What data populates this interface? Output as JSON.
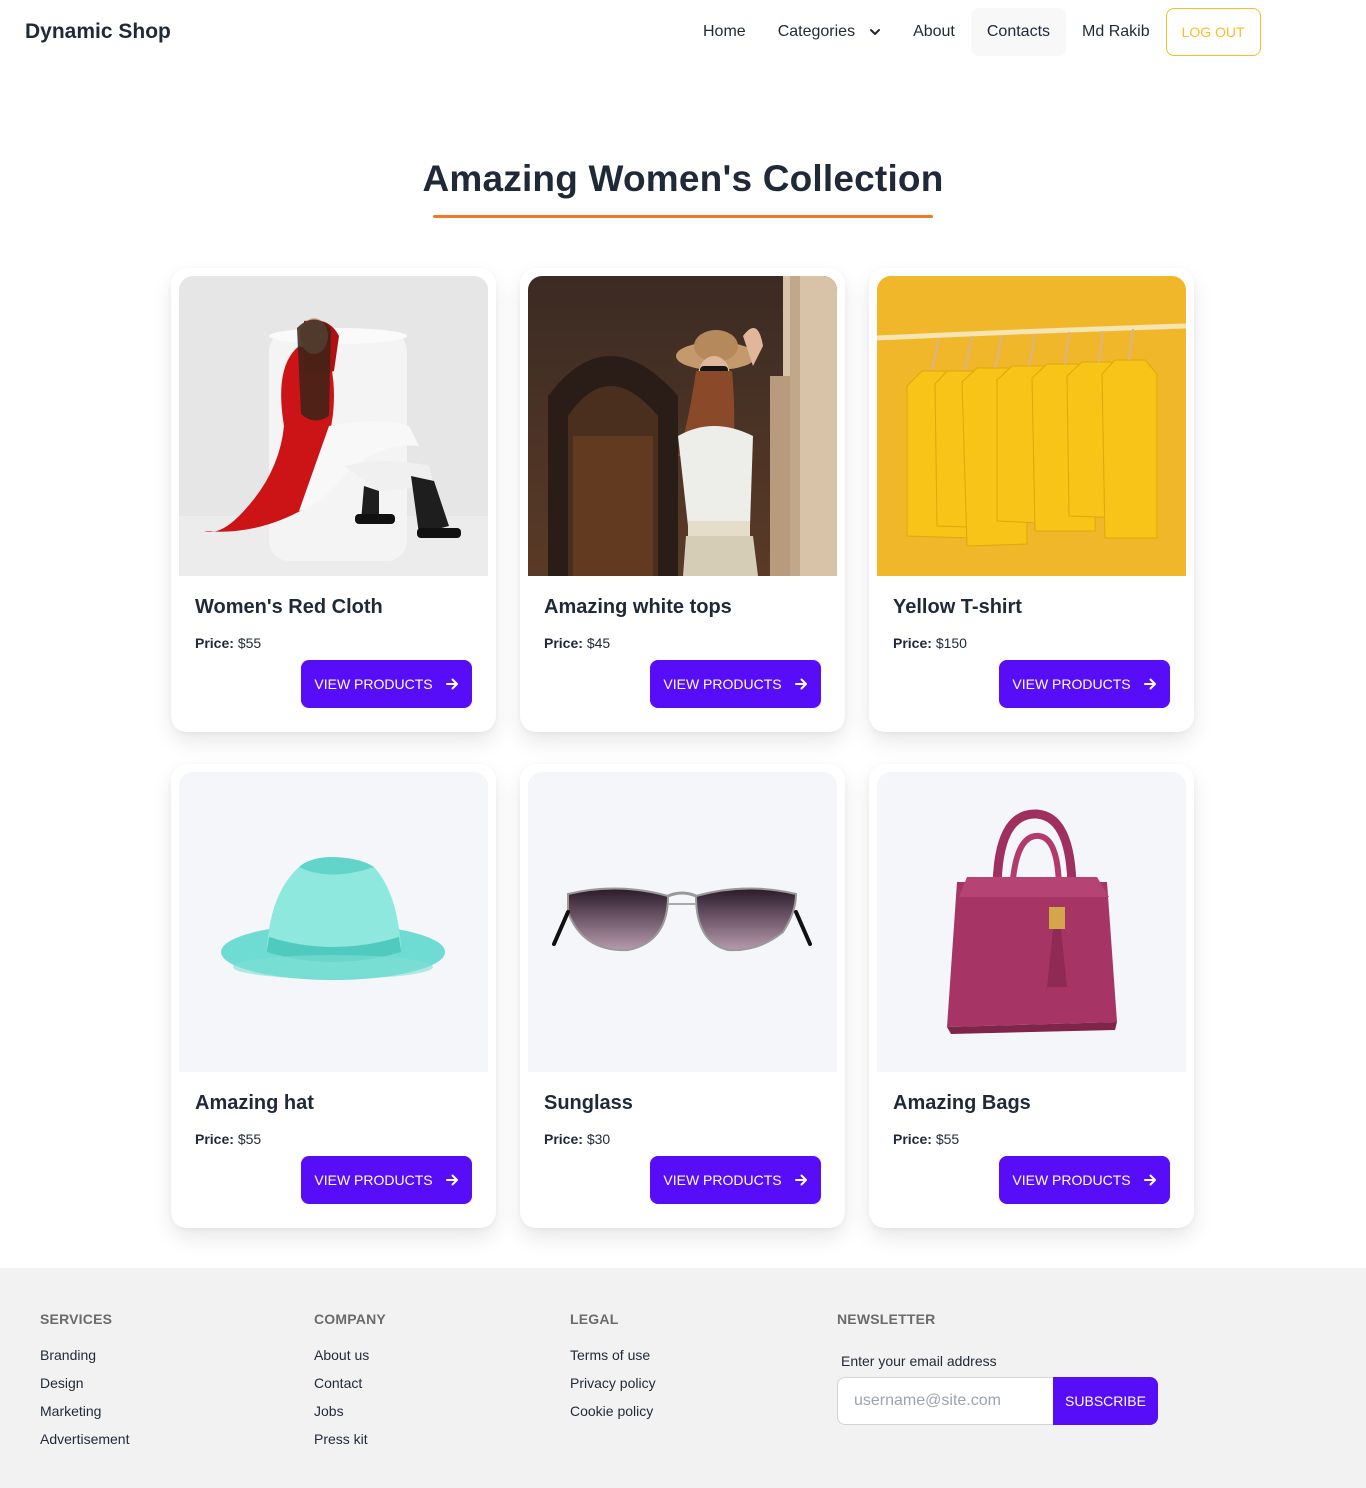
{
  "nav": {
    "brand": "Dynamic Shop",
    "links": [
      "Home",
      "Categories",
      "About",
      "Contacts",
      "Md Rakib"
    ],
    "logout": "LOG OUT"
  },
  "hero": {
    "title": "Amazing Women's Collection"
  },
  "products": [
    {
      "name": "Women's Red Cloth",
      "price_label": "Price:",
      "price": "$55",
      "button": "VIEW PRODUCTS"
    },
    {
      "name": "Amazing white tops",
      "price_label": "Price:",
      "price": "$45",
      "button": "VIEW PRODUCTS"
    },
    {
      "name": "Yellow T-shirt",
      "price_label": "Price:",
      "price": "$150",
      "button": "VIEW PRODUCTS"
    },
    {
      "name": "Amazing hat",
      "price_label": "Price:",
      "price": "$55",
      "button": "VIEW PRODUCTS"
    },
    {
      "name": "Sunglass",
      "price_label": "Price:",
      "price": "$30",
      "button": "VIEW PRODUCTS"
    },
    {
      "name": "Amazing Bags",
      "price_label": "Price:",
      "price": "$55",
      "button": "VIEW PRODUCTS"
    }
  ],
  "footer": {
    "services": {
      "title": "SERVICES",
      "links": [
        "Branding",
        "Design",
        "Marketing",
        "Advertisement"
      ]
    },
    "company": {
      "title": "COMPANY",
      "links": [
        "About us",
        "Contact",
        "Jobs",
        "Press kit"
      ]
    },
    "legal": {
      "title": "LEGAL",
      "links": [
        "Terms of use",
        "Privacy policy",
        "Cookie policy"
      ]
    },
    "newsletter": {
      "title": "NEWSLETTER",
      "label": "Enter your email address",
      "placeholder": "username@site.com",
      "button": "SUBSCRIBE"
    }
  },
  "colors": {
    "primary": "#570df8",
    "warning": "#fbbd23",
    "accent_underline": "#f07a1d",
    "footer_bg": "#f2f2f2"
  }
}
